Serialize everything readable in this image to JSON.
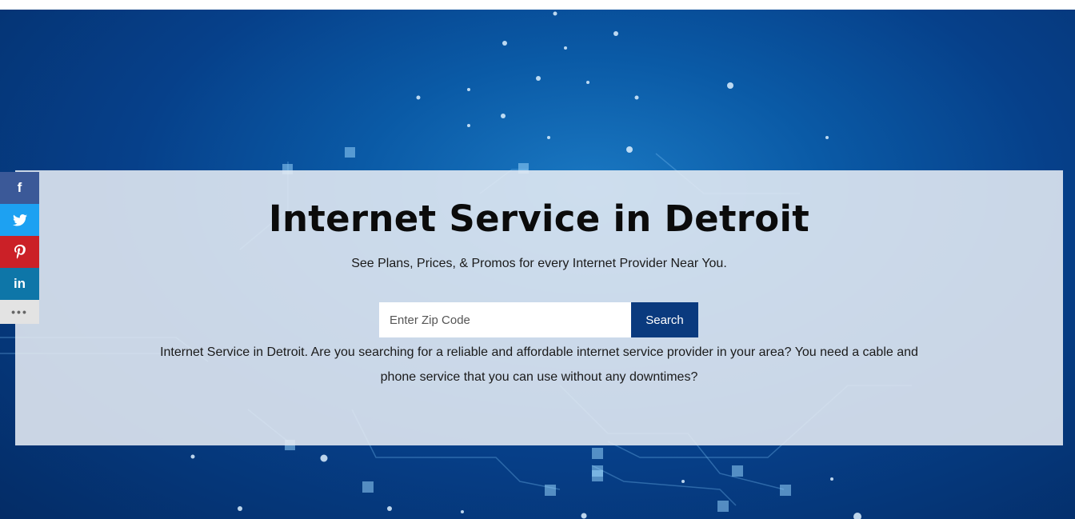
{
  "hero": {
    "title": "Internet Service in Detroit",
    "subtitle": "See Plans, Prices, & Promos for every Internet Provider Near You.",
    "description": "Internet Service in Detroit. Are you searching for a reliable and affordable internet service provider in your area? You need a cable and phone service that you can use without any downtimes?"
  },
  "search": {
    "placeholder": "Enter Zip Code",
    "value": "",
    "button_label": "Search"
  },
  "share": {
    "facebook_glyph": "f",
    "twitter_icon": "twitter-icon",
    "pinterest_icon": "pinterest-icon",
    "linkedin_glyph": "in",
    "more_glyph": "•••"
  },
  "colors": {
    "search_button": "#0a3a7e",
    "facebook": "#3b5998",
    "twitter": "#1da1f2",
    "pinterest": "#cb2027",
    "linkedin": "#0e76a8"
  }
}
